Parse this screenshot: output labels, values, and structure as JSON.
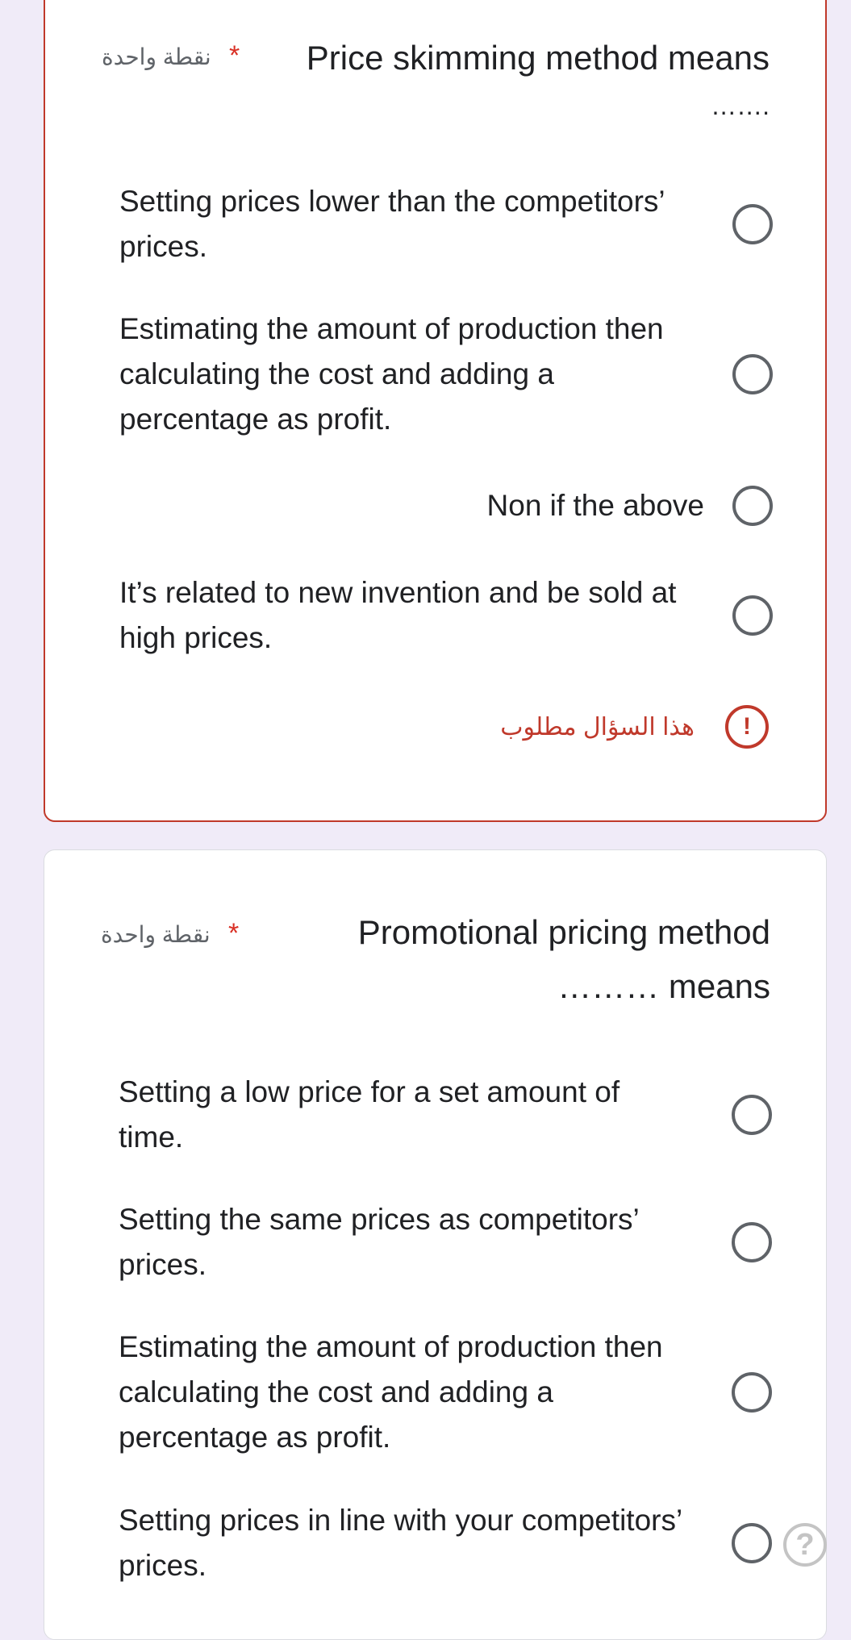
{
  "questions": [
    {
      "points": "نقطة واحدة",
      "required_star": "*",
      "title": "Price skimming method means",
      "title_suffix": "…….",
      "options": [
        "Setting prices lower than the competitors’ prices.",
        "Estimating the amount of production then calculating the cost and adding a percentage as profit.",
        "Non if the above",
        "It’s related to new invention and be sold at high prices."
      ],
      "error_icon": "!",
      "error_message": "هذا السؤال مطلوب"
    },
    {
      "points": "نقطة واحدة",
      "required_star": "*",
      "title_line1": "Promotional pricing method",
      "title_line2": "……… means",
      "options": [
        "Setting a low price for a set amount of time.",
        "Setting the same prices as competitors’ prices.",
        "Estimating the amount of production then calculating the cost and adding a percentage as profit.",
        "Setting prices in line with your competitors’ prices."
      ]
    }
  ],
  "help": {
    "label": "?"
  },
  "colors": {
    "background": "#f0ebf8",
    "error": "#c0392b",
    "required": "#d93025",
    "radio_border": "#5f6368"
  }
}
